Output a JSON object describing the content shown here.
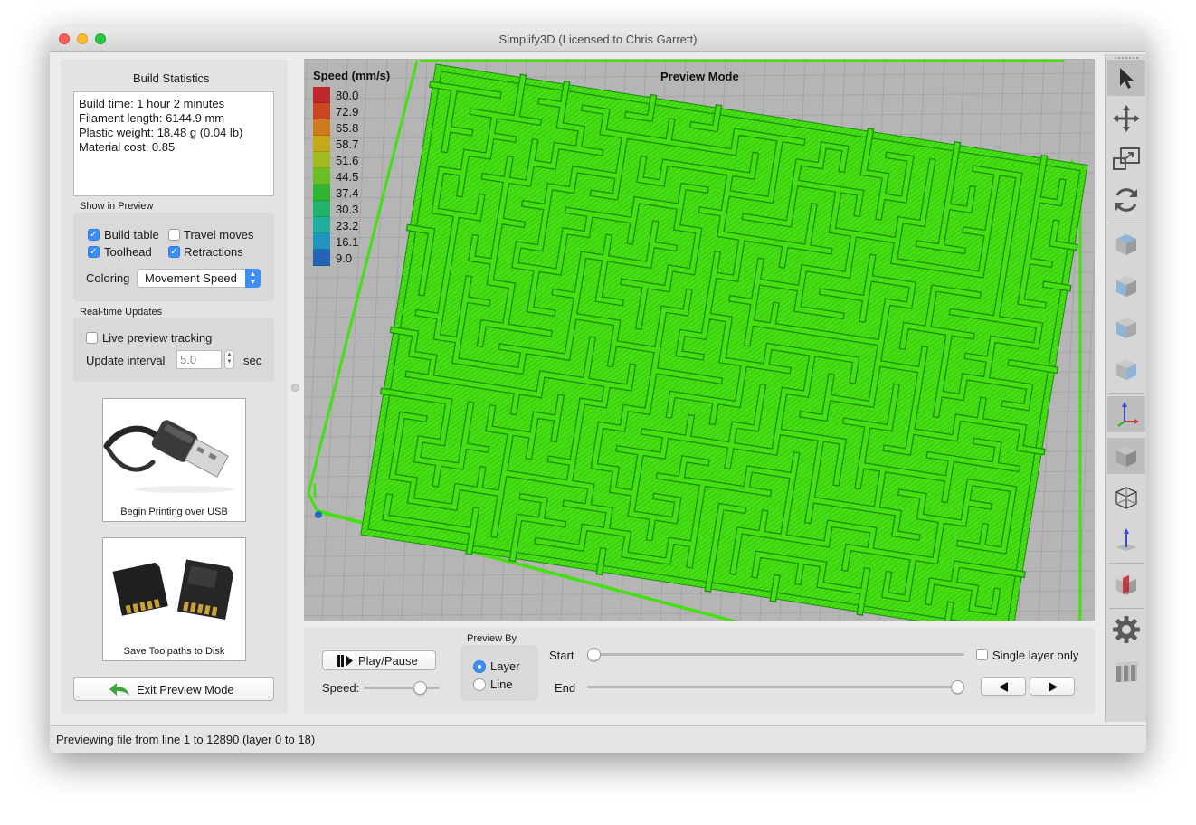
{
  "window": {
    "title": "Simplify3D (Licensed to Chris Garrett)"
  },
  "left_panel": {
    "build_statistics_title": "Build Statistics",
    "stats": [
      "Build time: 1 hour 2 minutes",
      "Filament length: 6144.9 mm",
      "Plastic weight: 18.48 g (0.04 lb)",
      "Material cost: 0.85"
    ],
    "show_in_preview_title": "Show in Preview",
    "build_table": {
      "label": "Build table",
      "checked": true
    },
    "travel_moves": {
      "label": "Travel moves",
      "checked": false
    },
    "toolhead": {
      "label": "Toolhead",
      "checked": true
    },
    "retractions": {
      "label": "Retractions",
      "checked": true
    },
    "coloring_label": "Coloring",
    "coloring_value": "Movement Speed",
    "realtime_title": "Real-time Updates",
    "live_preview": {
      "label": "Live preview tracking",
      "checked": false
    },
    "update_interval_label": "Update interval",
    "update_interval_value": "5.0",
    "update_interval_unit": "sec",
    "usb_button_label": "Begin Printing over USB",
    "disk_button_label": "Save Toolpaths to Disk",
    "exit_button_label": "Exit Preview Mode"
  },
  "viewport": {
    "legend_title": "Speed (mm/s)",
    "mode_label": "Preview Mode",
    "legend": [
      {
        "value": "80.0",
        "color": "#c0272a"
      },
      {
        "value": "72.9",
        "color": "#c9461f"
      },
      {
        "value": "65.8",
        "color": "#cf7a1d"
      },
      {
        "value": "58.7",
        "color": "#c4a91b"
      },
      {
        "value": "51.6",
        "color": "#a2bb1e"
      },
      {
        "value": "44.5",
        "color": "#6abf25"
      },
      {
        "value": "37.4",
        "color": "#2fb52f"
      },
      {
        "value": "30.3",
        "color": "#20b46a"
      },
      {
        "value": "23.2",
        "color": "#1fb0a0"
      },
      {
        "value": "16.1",
        "color": "#1f95c0"
      },
      {
        "value": "9.0",
        "color": "#2364b8"
      }
    ],
    "toolpath_color": "#44e011"
  },
  "bottom_panel": {
    "play_pause_label": "Play/Pause",
    "speed_label": "Speed:",
    "speed_fraction": 0.8,
    "preview_by_title": "Preview By",
    "layer_option": "Layer",
    "line_option": "Line",
    "preview_by_selected": "Layer",
    "start_label": "Start",
    "end_label": "End",
    "start_fraction": 0.0,
    "end_fraction": 1.0,
    "single_layer_label": "Single layer only",
    "single_layer_checked": false
  },
  "toolbar": {
    "tools": [
      "select-pointer-icon",
      "move-icon",
      "scale-icon",
      "rotate-icon",
      "view-top-icon",
      "view-front-icon",
      "view-left-icon",
      "view-right-icon",
      "axes-icon",
      "solid-view-icon",
      "wireframe-icon",
      "normals-icon",
      "cross-section-icon",
      "settings-gear-icon",
      "supports-icon"
    ]
  },
  "status": {
    "text": "Previewing file from line 1 to 12890 (layer 0 to 18)"
  }
}
